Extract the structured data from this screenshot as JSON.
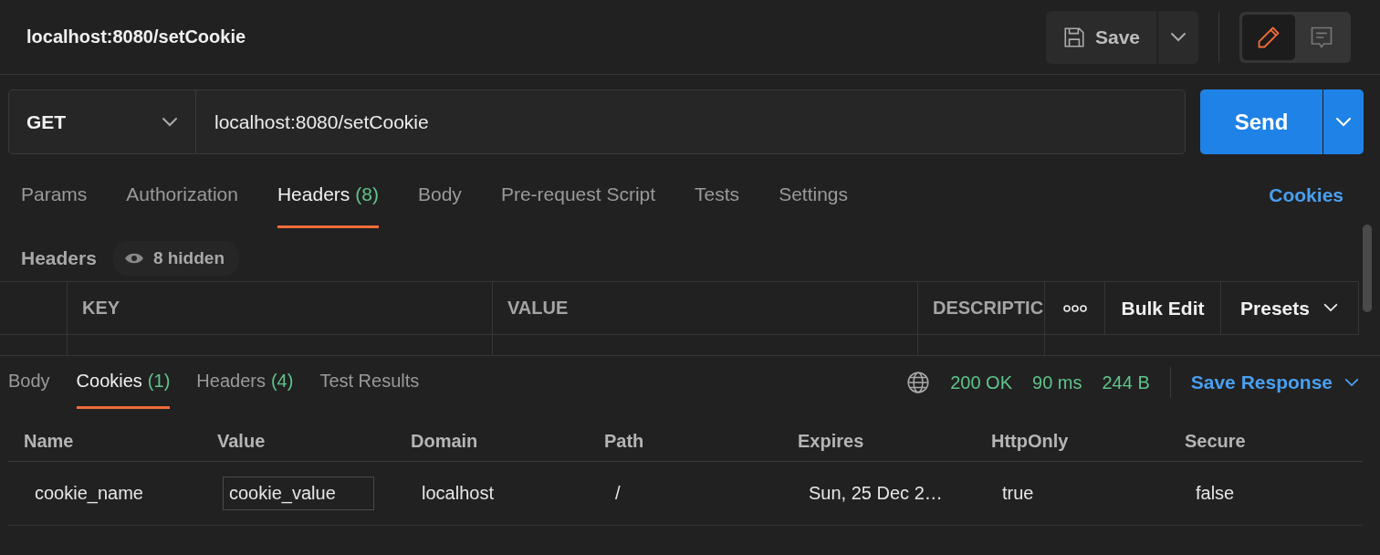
{
  "header": {
    "title": "localhost:8080/setCookie",
    "save_label": "Save",
    "modes": [
      {
        "kind": "edit",
        "selected": true
      },
      {
        "kind": "comment",
        "selected": false
      }
    ]
  },
  "url_bar": {
    "method": "GET",
    "url": "localhost:8080/setCookie",
    "send_label": "Send"
  },
  "request_tabs": [
    {
      "label": "Params",
      "selected": false
    },
    {
      "label": "Authorization",
      "selected": false
    },
    {
      "label": "Headers",
      "count": "(8)",
      "selected": true
    },
    {
      "label": "Body",
      "selected": false
    },
    {
      "label": "Pre-request Script",
      "selected": false
    },
    {
      "label": "Tests",
      "selected": false
    },
    {
      "label": "Settings",
      "selected": false
    }
  ],
  "cookies_link": "Cookies",
  "headers_section": {
    "title": "Headers",
    "hidden_label": "8 hidden",
    "columns": [
      "KEY",
      "VALUE",
      "DESCRIPTIC"
    ],
    "bulk_edit": "Bulk Edit",
    "presets": "Presets"
  },
  "response_tabs": [
    {
      "label": "Body",
      "selected": false
    },
    {
      "label": "Cookies",
      "count": "(1)",
      "selected": true
    },
    {
      "label": "Headers",
      "count": "(4)",
      "selected": false
    },
    {
      "label": "Test Results",
      "selected": false
    }
  ],
  "response_meta": {
    "status": "200 OK",
    "time": "90 ms",
    "size": "244 B",
    "save_response": "Save Response"
  },
  "cookies_table": {
    "columns": [
      "Name",
      "Value",
      "Domain",
      "Path",
      "Expires",
      "HttpOnly",
      "Secure"
    ],
    "rows": [
      {
        "name": "cookie_name",
        "value": "cookie_value",
        "domain": "localhost",
        "path": "/",
        "expires": "Sun, 25 Dec 2…",
        "http_only": "true",
        "secure": "false"
      }
    ]
  }
}
